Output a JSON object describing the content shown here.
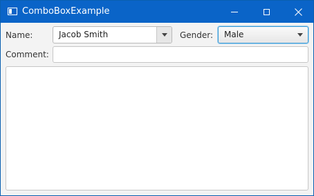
{
  "window": {
    "title": "ComboBoxExample",
    "icon": "window-icon"
  },
  "form": {
    "name_label": "Name:",
    "name_value": "Jacob Smith",
    "gender_label": "Gender:",
    "gender_value": "Male",
    "comment_label": "Comment:",
    "comment_value": ""
  },
  "colors": {
    "titlebar": "#0a64c8",
    "focus_border": "#3c9bd6"
  }
}
